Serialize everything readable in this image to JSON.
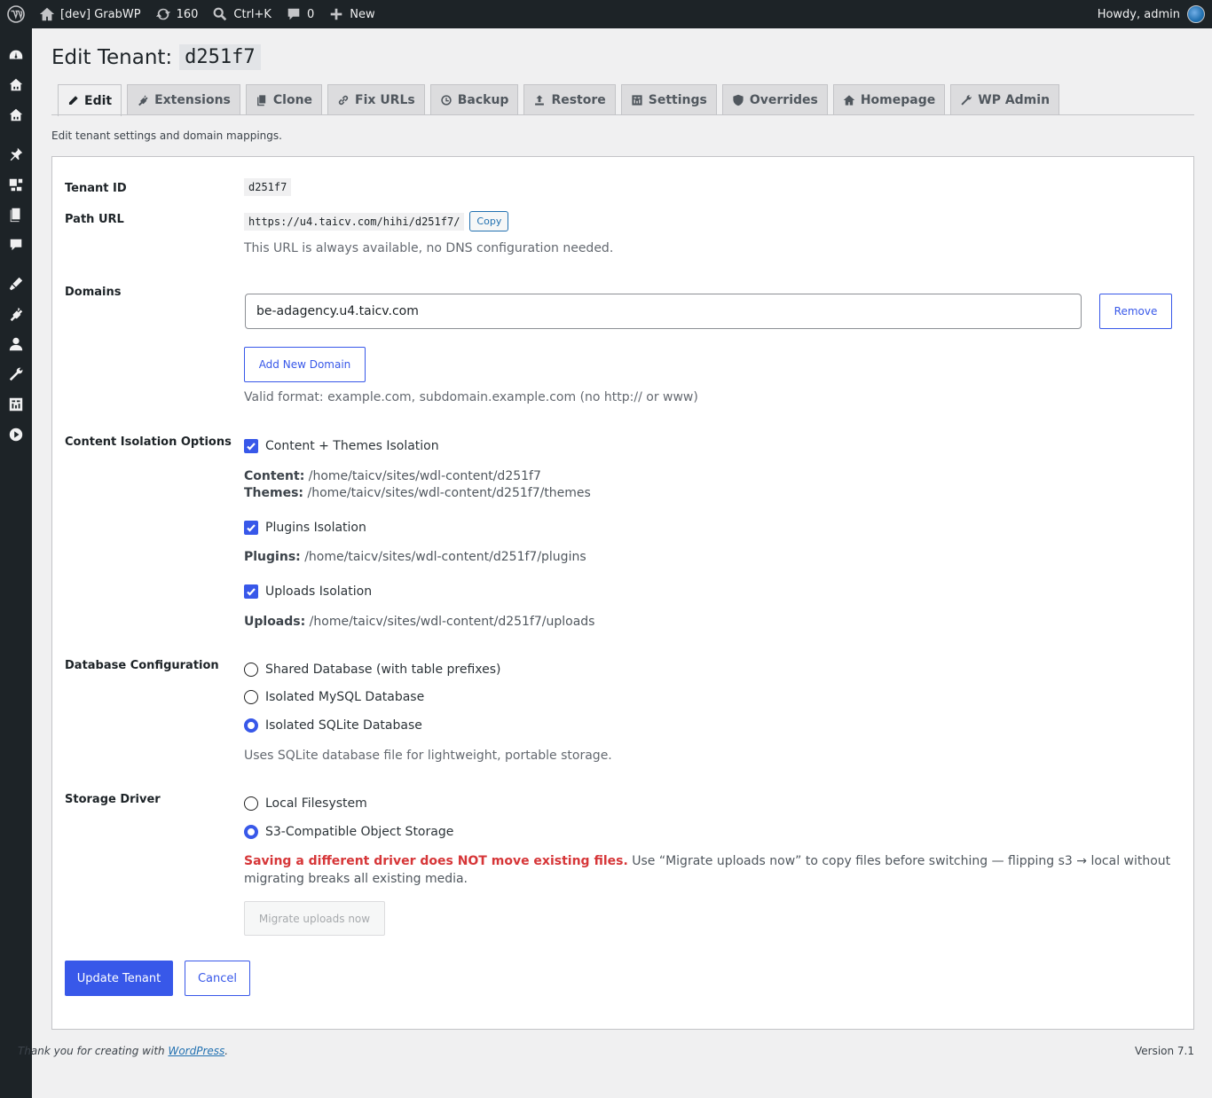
{
  "adminbar": {
    "site_name": "[dev] GrabWP",
    "updates_count": "160",
    "search_label": "Ctrl+K",
    "comments_count": "0",
    "new_label": "New",
    "howdy": "Howdy, admin"
  },
  "page": {
    "title_prefix": "Edit Tenant:",
    "tenant_code": "d251f7",
    "description": "Edit tenant settings and domain mappings."
  },
  "tabs": [
    {
      "label": "Edit",
      "icon": "pencil-icon",
      "active": true
    },
    {
      "label": "Extensions",
      "icon": "plugin-icon"
    },
    {
      "label": "Clone",
      "icon": "copy-icon"
    },
    {
      "label": "Fix URLs",
      "icon": "link-icon"
    },
    {
      "label": "Backup",
      "icon": "backup-icon"
    },
    {
      "label": "Restore",
      "icon": "upload-icon"
    },
    {
      "label": "Settings",
      "icon": "settings-icon"
    },
    {
      "label": "Overrides",
      "icon": "shield-icon"
    },
    {
      "label": "Homepage",
      "icon": "home-icon"
    },
    {
      "label": "WP Admin",
      "icon": "wrench-icon"
    }
  ],
  "form": {
    "tenant_id_label": "Tenant ID",
    "tenant_id_value": "d251f7",
    "path_url_label": "Path URL",
    "path_url_value": "https://u4.taicv.com/hihi/d251f7/",
    "copy_label": "Copy",
    "path_url_note": "This URL is always available, no DNS configuration needed.",
    "domains_label": "Domains",
    "domain_value": "be-adagency.u4.taicv.com",
    "remove_label": "Remove",
    "add_domain_label": "Add New Domain",
    "domain_note": "Valid format: example.com, subdomain.example.com (no http:// or www)",
    "isolation_label": "Content Isolation Options",
    "isolation": {
      "content_themes_label": "Content + Themes Isolation",
      "content_key": "Content:",
      "content_path": " /home/taicv/sites/wdl-content/d251f7",
      "themes_key": "Themes:",
      "themes_path": " /home/taicv/sites/wdl-content/d251f7/themes",
      "plugins_label": "Plugins Isolation",
      "plugins_key": "Plugins:",
      "plugins_path": " /home/taicv/sites/wdl-content/d251f7/plugins",
      "uploads_label": "Uploads Isolation",
      "uploads_key": "Uploads:",
      "uploads_path": " /home/taicv/sites/wdl-content/d251f7/uploads"
    },
    "db_label": "Database Configuration",
    "db_options": [
      "Shared Database (with table prefixes)",
      "Isolated MySQL Database",
      "Isolated SQLite Database"
    ],
    "db_selected": "Isolated SQLite Database",
    "db_note": "Uses SQLite database file for lightweight, portable storage.",
    "storage_label": "Storage Driver",
    "storage_options": [
      "Local Filesystem",
      "S3-Compatible Object Storage"
    ],
    "storage_selected": "S3-Compatible Object Storage",
    "storage_warning_bold": "Saving a different driver does NOT move existing files.",
    "storage_warning_rest": " Use “Migrate uploads now” to copy files before switching — flipping s3 → local without migrating breaks all existing media.",
    "migrate_label": "Migrate uploads now",
    "update_label": "Update Tenant",
    "cancel_label": "Cancel"
  },
  "footer": {
    "thanks_prefix": "Thank you for creating with ",
    "thanks_link": "WordPress",
    "thanks_suffix": ".",
    "version": "Version 7.1"
  },
  "colors": {
    "accent": "#3858e9",
    "admin_bar": "#1d2327",
    "warning": "#d63638",
    "link": "#2271b1"
  }
}
